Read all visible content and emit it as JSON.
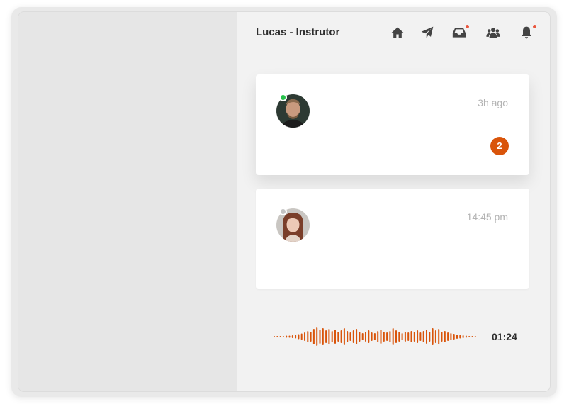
{
  "header": {
    "title": "Lucas - Instrutor",
    "icons": [
      "home-icon",
      "send-icon",
      "inbox-icon",
      "users-icon",
      "bell-icon"
    ]
  },
  "conversations": [
    {
      "time": "3h ago",
      "status": "online",
      "unread": "2"
    },
    {
      "time": "14:45 pm",
      "status": "offline"
    }
  ],
  "audio": {
    "duration": "01:24"
  },
  "colors": {
    "accent": "#d9540a",
    "online": "#27c24c",
    "offline": "#c4c4c4",
    "notification": "#e9573f"
  }
}
